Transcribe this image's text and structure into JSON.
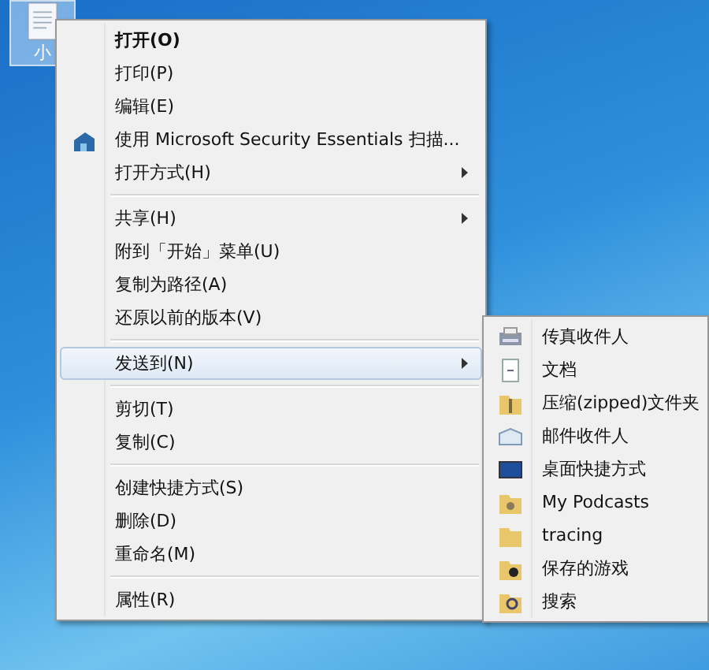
{
  "desktop_icon": {
    "label": "小"
  },
  "context_menu": {
    "items": [
      {
        "kind": "item",
        "label": "打开(O)",
        "default": true,
        "submenu": false,
        "selected": false
      },
      {
        "kind": "item",
        "label": "打印(P)",
        "default": false,
        "submenu": false,
        "selected": false
      },
      {
        "kind": "item",
        "label": "编辑(E)",
        "default": false,
        "submenu": false,
        "selected": false
      },
      {
        "kind": "scan",
        "label": "使用 Microsoft Security Essentials 扫描...",
        "default": false,
        "submenu": false,
        "selected": false
      },
      {
        "kind": "item",
        "label": "打开方式(H)",
        "default": false,
        "submenu": true,
        "selected": false
      },
      {
        "kind": "separator"
      },
      {
        "kind": "item",
        "label": "共享(H)",
        "default": false,
        "submenu": true,
        "selected": false
      },
      {
        "kind": "item",
        "label": "附到「开始」菜单(U)",
        "default": false,
        "submenu": false,
        "selected": false
      },
      {
        "kind": "item",
        "label": "复制为路径(A)",
        "default": false,
        "submenu": false,
        "selected": false
      },
      {
        "kind": "item",
        "label": "还原以前的版本(V)",
        "default": false,
        "submenu": false,
        "selected": false
      },
      {
        "kind": "separator"
      },
      {
        "kind": "item",
        "label": "发送到(N)",
        "default": false,
        "submenu": true,
        "selected": true
      },
      {
        "kind": "separator"
      },
      {
        "kind": "item",
        "label": "剪切(T)",
        "default": false,
        "submenu": false,
        "selected": false
      },
      {
        "kind": "item",
        "label": "复制(C)",
        "default": false,
        "submenu": false,
        "selected": false
      },
      {
        "kind": "separator"
      },
      {
        "kind": "item",
        "label": "创建快捷方式(S)",
        "default": false,
        "submenu": false,
        "selected": false
      },
      {
        "kind": "item",
        "label": "删除(D)",
        "default": false,
        "submenu": false,
        "selected": false
      },
      {
        "kind": "item",
        "label": "重命名(M)",
        "default": false,
        "submenu": false,
        "selected": false
      },
      {
        "kind": "separator"
      },
      {
        "kind": "item",
        "label": "属性(R)",
        "default": false,
        "submenu": false,
        "selected": false
      }
    ]
  },
  "send_to_menu": {
    "items": [
      {
        "kind": "fax",
        "label": "传真收件人"
      },
      {
        "kind": "document",
        "label": "文档"
      },
      {
        "kind": "zip",
        "label": "压缩(zipped)文件夹"
      },
      {
        "kind": "mail",
        "label": "邮件收件人"
      },
      {
        "kind": "desktop",
        "label": "桌面快捷方式"
      },
      {
        "kind": "podcast",
        "label": "My Podcasts"
      },
      {
        "kind": "folder",
        "label": "tracing"
      },
      {
        "kind": "games",
        "label": "保存的游戏"
      },
      {
        "kind": "search",
        "label": "搜索"
      }
    ]
  }
}
